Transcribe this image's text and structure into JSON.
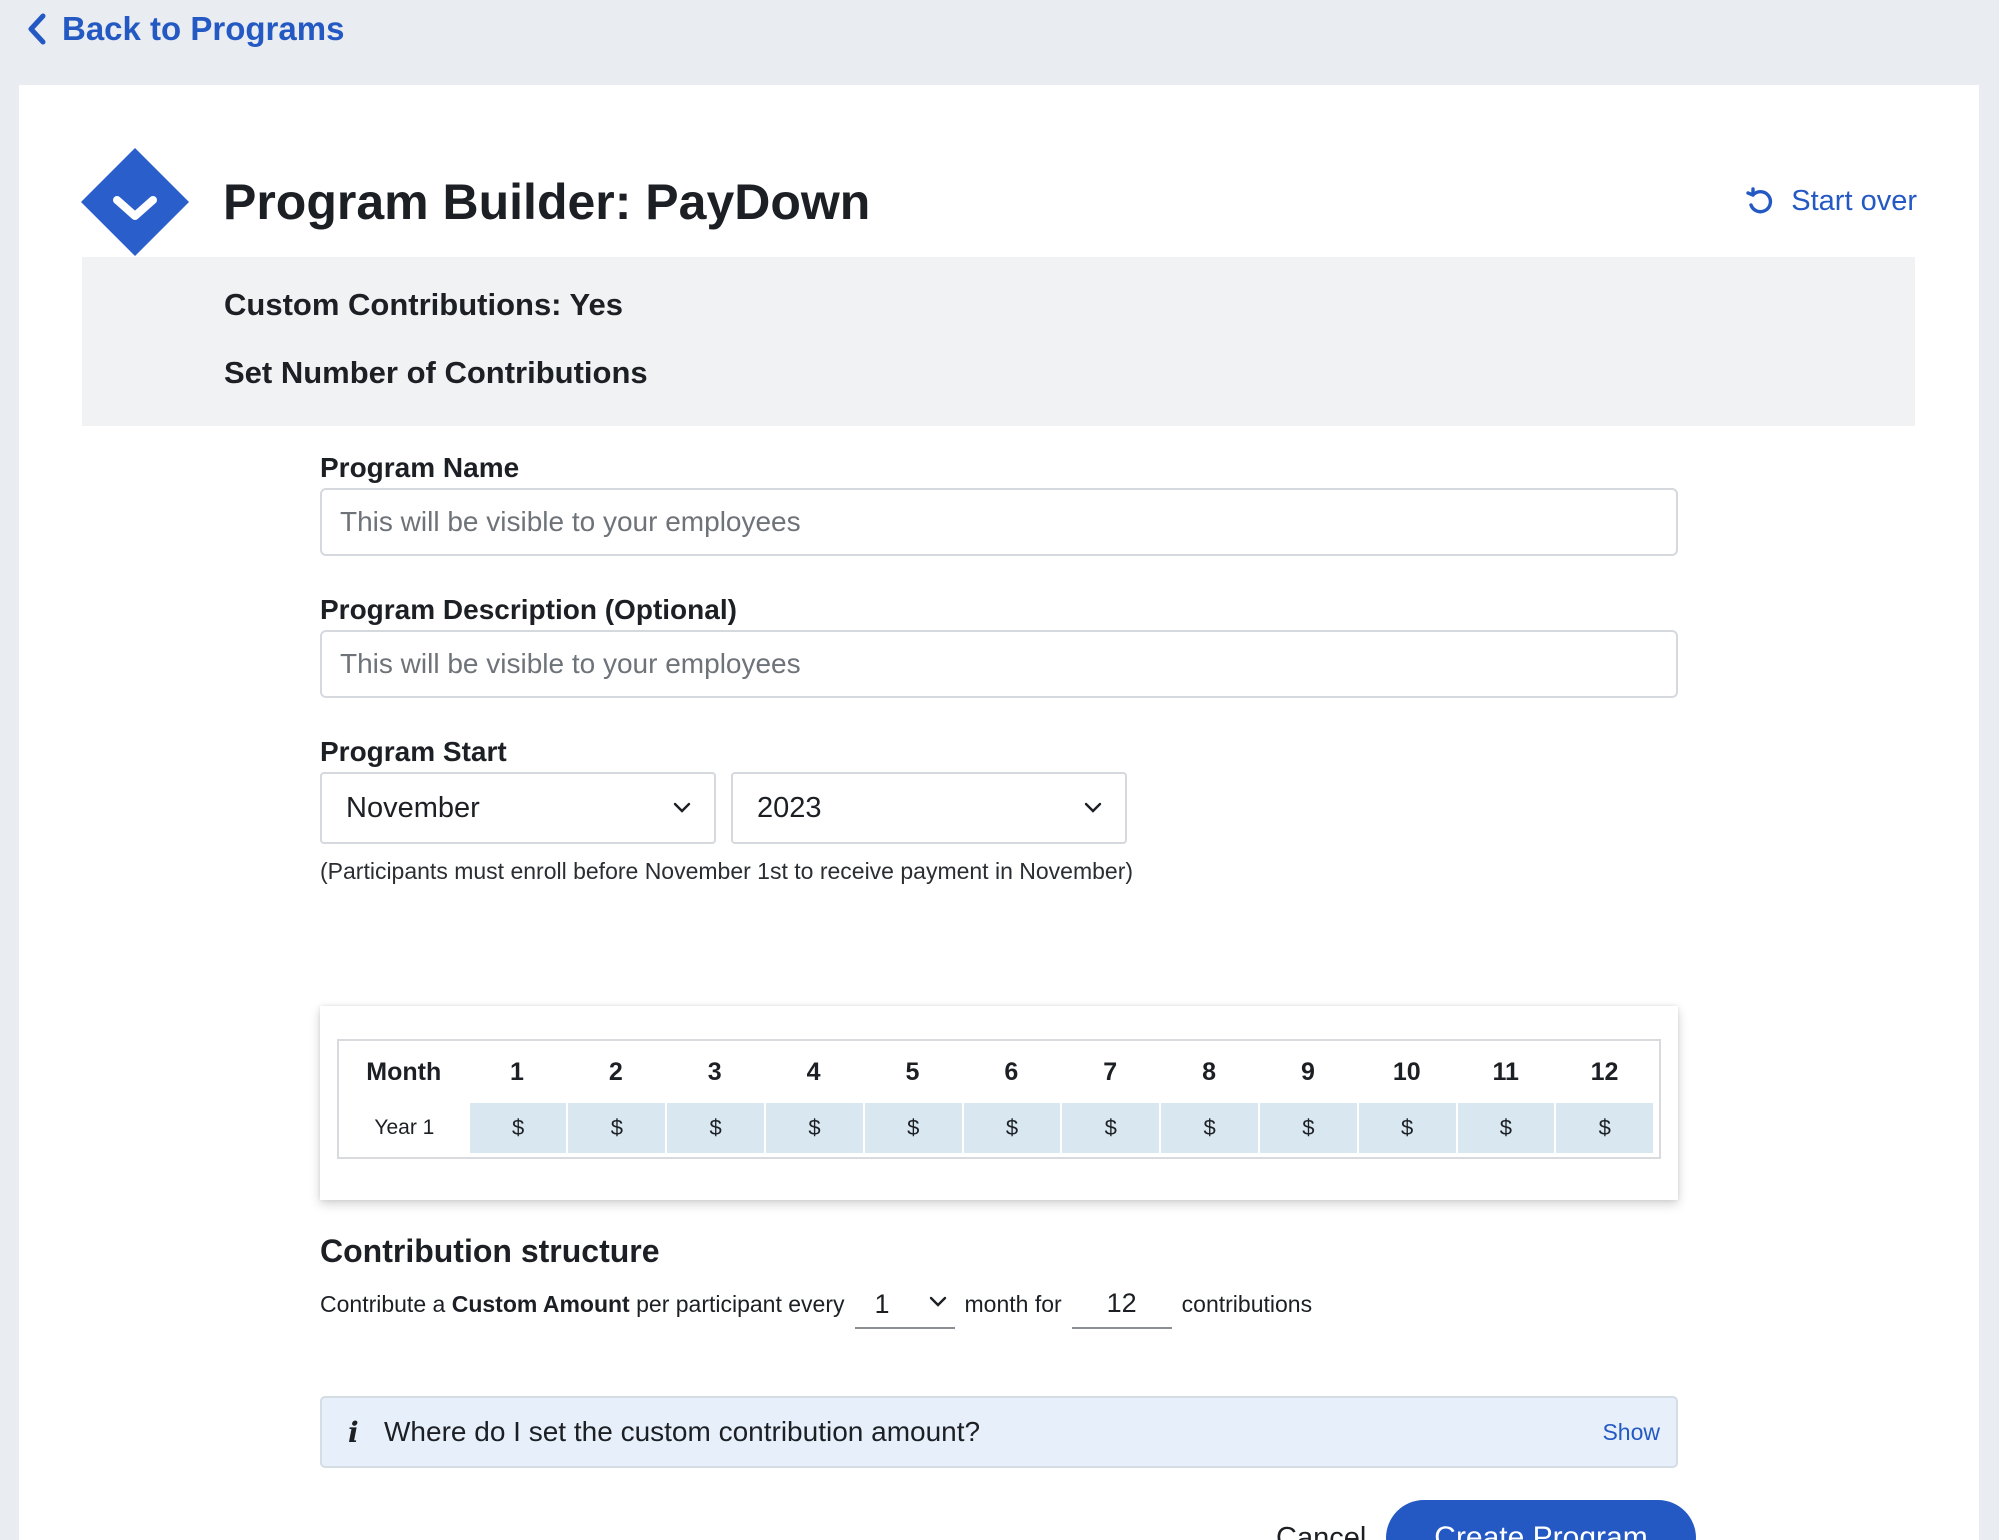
{
  "nav": {
    "back_label": "Back to Programs"
  },
  "header": {
    "title": "Program Builder: PayDown",
    "start_over_label": "Start over"
  },
  "summary": {
    "custom_contributions": "Custom Contributions: Yes",
    "set_number": "Set Number of Contributions"
  },
  "form": {
    "program_name_label": "Program Name",
    "program_name_placeholder": "This will be visible to your employees",
    "program_name_value": "",
    "description_label": "Program Description (Optional)",
    "description_placeholder": "This will be visible to your employees",
    "description_value": "",
    "start_label": "Program Start",
    "start_month": "November",
    "start_year": "2023",
    "enroll_hint": "(Participants must enroll before November 1st to receive payment in November)"
  },
  "schedule": {
    "month_header": "Month",
    "months": [
      "1",
      "2",
      "3",
      "4",
      "5",
      "6",
      "7",
      "8",
      "9",
      "10",
      "11",
      "12"
    ],
    "row_label": "Year 1",
    "cells": [
      "$",
      "$",
      "$",
      "$",
      "$",
      "$",
      "$",
      "$",
      "$",
      "$",
      "$",
      "$"
    ]
  },
  "structure": {
    "title": "Contribution structure",
    "prefix": "Contribute a",
    "amount_type": "Custom Amount",
    "middle": "per participant every",
    "interval": "1",
    "month_for": "month for",
    "count": "12",
    "suffix": "contributions"
  },
  "info": {
    "icon": "info-icon",
    "question": "Where do I set the custom contribution amount?",
    "toggle_label": "Show"
  },
  "actions": {
    "cancel_label": "Cancel",
    "create_label": "Create Program"
  },
  "colors": {
    "accent": "#2459c4",
    "cell_bg": "#d9e7f0",
    "info_bg": "#e7f0fa"
  }
}
